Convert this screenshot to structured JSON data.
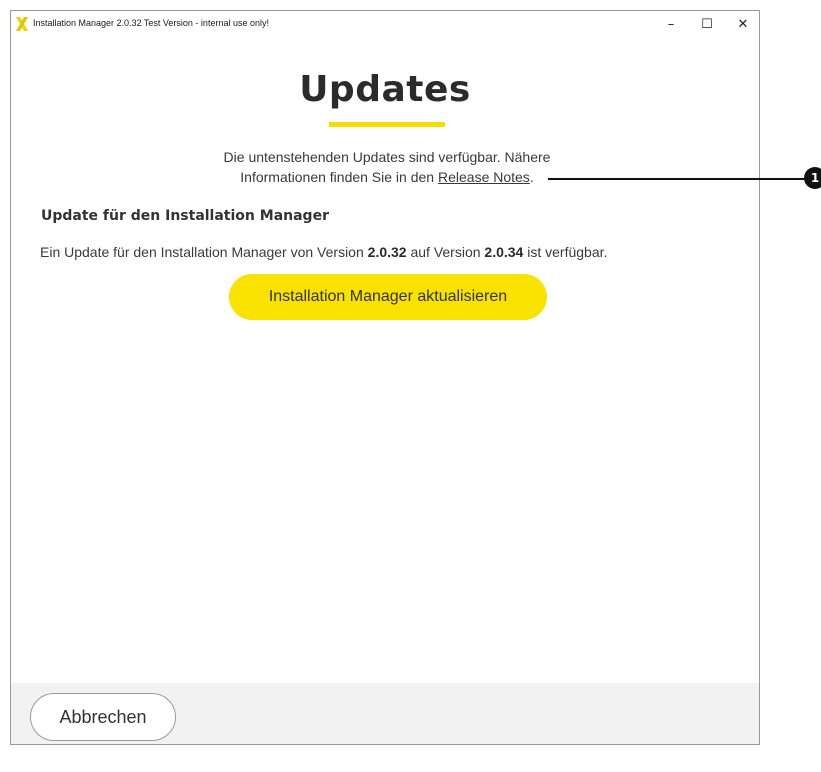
{
  "window": {
    "title": "Installation Manager 2.0.32 Test Version - internal use only!",
    "controls": {
      "minimize": "–",
      "maximize": "☐",
      "close": "✕"
    }
  },
  "page": {
    "title": "Updates",
    "intro_line1": "Die untenstehenden Updates sind verfügbar. Nähere",
    "intro_line2_prefix": "Informationen finden Sie in den ",
    "release_notes_link": "Release Notes",
    "intro_line2_suffix": "."
  },
  "update": {
    "heading": "Update für den Installation Manager",
    "text_prefix": "Ein Update für den Installation Manager von Version ",
    "from_version": "2.0.32",
    "text_middle": " auf Version ",
    "to_version": "2.0.34",
    "text_suffix": " ist verfügbar.",
    "button_label": "Installation Manager aktualisieren"
  },
  "footer": {
    "cancel_label": "Abbrechen"
  },
  "callout": {
    "number": "1"
  },
  "colors": {
    "accent": "#f9e100",
    "title_underline": "#f7dc00",
    "footer_bg": "#f2f2f2",
    "text": "#333333"
  },
  "icons": {
    "app": "x-logo-icon",
    "minimize": "minimize-icon",
    "maximize": "maximize-icon",
    "close": "close-icon"
  }
}
